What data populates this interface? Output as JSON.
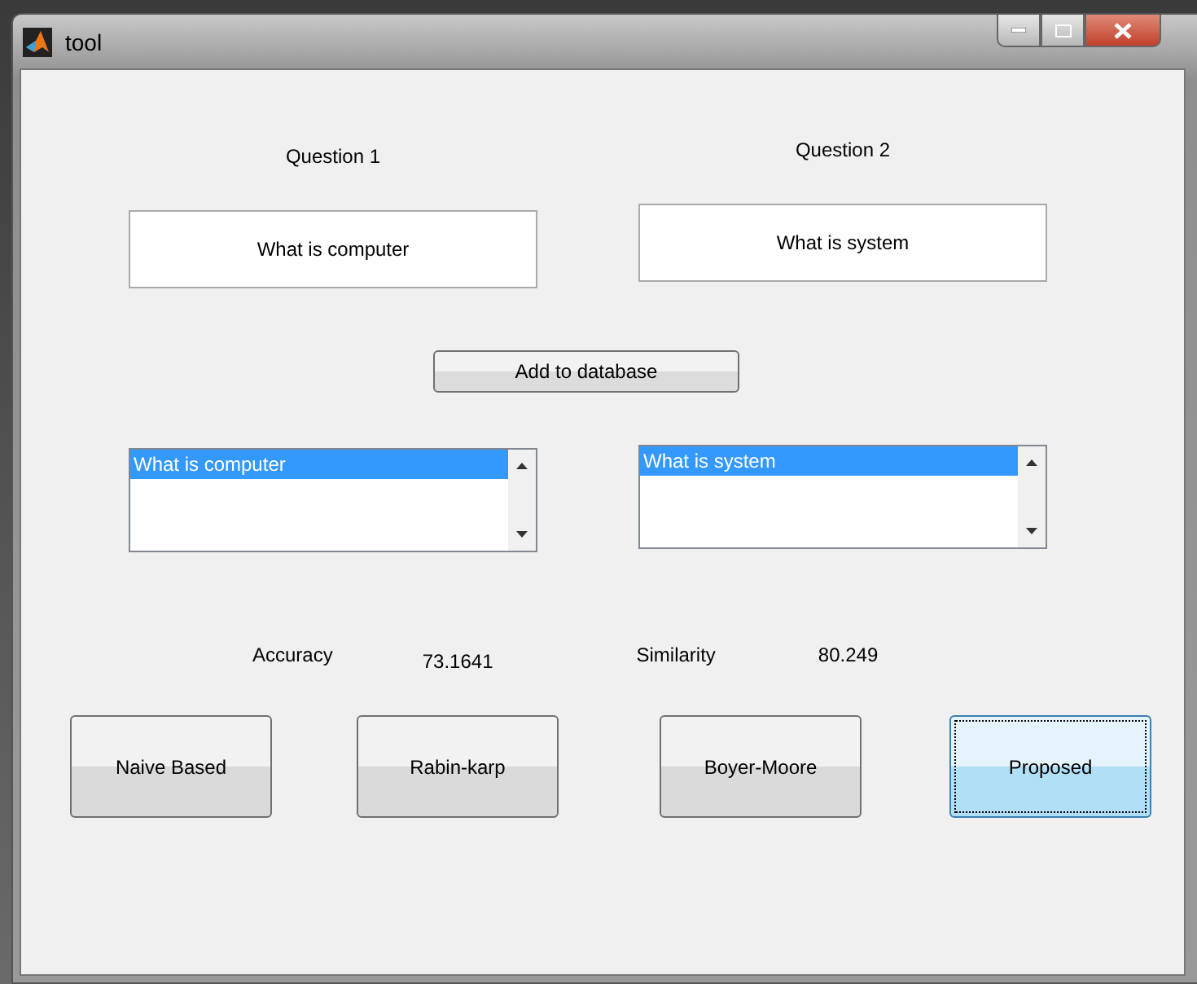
{
  "window": {
    "title": "tool"
  },
  "questions": [
    {
      "label": "Question 1",
      "value": "What is computer",
      "list": [
        {
          "text": "What is computer",
          "selected": true
        }
      ]
    },
    {
      "label": "Question 2",
      "value": "What is system",
      "list": [
        {
          "text": "What is system",
          "selected": true
        }
      ]
    }
  ],
  "add_button": "Add to database",
  "results": [
    {
      "label": "Accuracy",
      "value": "73.1641"
    },
    {
      "label": "Similarity",
      "value": "80.249"
    }
  ],
  "buttons": [
    {
      "label": "Naive Based",
      "selected": false
    },
    {
      "label": "Rabin-karp",
      "selected": false
    },
    {
      "label": "Boyer-Moore",
      "selected": false
    },
    {
      "label": "Proposed",
      "selected": true
    }
  ]
}
